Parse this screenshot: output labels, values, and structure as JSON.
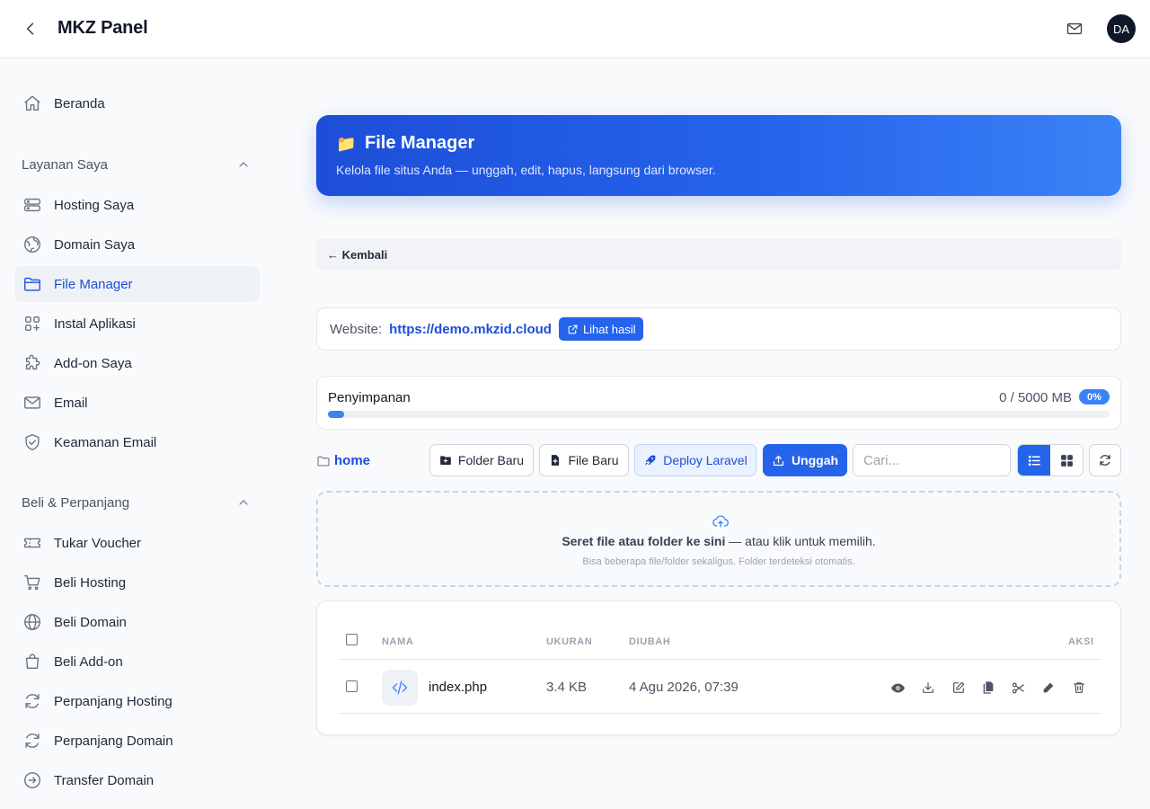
{
  "header": {
    "title": "MKZ Panel",
    "avatar_initials": "DA"
  },
  "sidebar": {
    "home": {
      "label": "Beranda",
      "icon": "home-icon"
    },
    "section_services": {
      "label": "Layanan Saya"
    },
    "services": [
      {
        "label": "Hosting Saya",
        "icon": "server-icon"
      },
      {
        "label": "Domain Saya",
        "icon": "globe-icon"
      },
      {
        "label": "File Manager",
        "icon": "folder-icon",
        "active": true
      },
      {
        "label": "Instal Aplikasi",
        "icon": "apps-icon"
      },
      {
        "label": "Add-on Saya",
        "icon": "puzzle-icon"
      },
      {
        "label": "Email",
        "icon": "mail-icon"
      },
      {
        "label": "Keamanan Email",
        "icon": "shield-icon"
      }
    ],
    "section_buy": {
      "label": "Beli & Perpanjang"
    },
    "buy": [
      {
        "label": "Tukar Voucher",
        "icon": "ticket-icon"
      },
      {
        "label": "Beli Hosting",
        "icon": "cart-icon"
      },
      {
        "label": "Beli Domain",
        "icon": "globe-icon"
      },
      {
        "label": "Beli Add-on",
        "icon": "bag-icon"
      },
      {
        "label": "Perpanjang Hosting",
        "icon": "refresh-icon"
      },
      {
        "label": "Perpanjang Domain",
        "icon": "refresh-icon"
      },
      {
        "label": "Transfer Domain",
        "icon": "arrow-circle-icon"
      }
    ]
  },
  "hero": {
    "emoji": "📁",
    "title": "File Manager",
    "description": "Kelola file situs Anda — unggah, edit, hapus, langsung dari browser."
  },
  "back_label": "← Kembali",
  "website": {
    "label": "Website:",
    "url": "https://demo.mkzid.cloud",
    "view_label": "Lihat hasil"
  },
  "storage": {
    "label": "Penyimpanan",
    "usage": "0 / 5000 MB",
    "percent_label": "0%",
    "percent": 0
  },
  "toolbar": {
    "path": "home",
    "new_folder": "Folder Baru",
    "new_file": "File Baru",
    "deploy": "Deploy Laravel",
    "upload": "Unggah",
    "search_placeholder": "Cari...",
    "view_mode": "list"
  },
  "dropzone": {
    "main_bold": "Seret file atau folder ke sini",
    "main_rest": " — atau klik untuk memilih.",
    "sub": "Bisa beberapa file/folder sekaligus. Folder terdeteksi otomatis."
  },
  "table": {
    "headers": {
      "name": "NAMA",
      "size": "UKURAN",
      "modified": "DIUBAH",
      "actions": "AKSI"
    },
    "rows": [
      {
        "name": "index.php",
        "size": "3.4 KB",
        "modified": "4 Agu 2026, 07:39",
        "icon": "code-file-icon",
        "actions": [
          "view-icon",
          "download-icon",
          "edit-icon",
          "copy-icon",
          "cut-icon",
          "rename-icon",
          "trash-icon"
        ]
      }
    ]
  },
  "colors": {
    "accent": "#2563eb",
    "link": "#1d4ed8",
    "sidebar_active_bg": "#eef2f7"
  }
}
